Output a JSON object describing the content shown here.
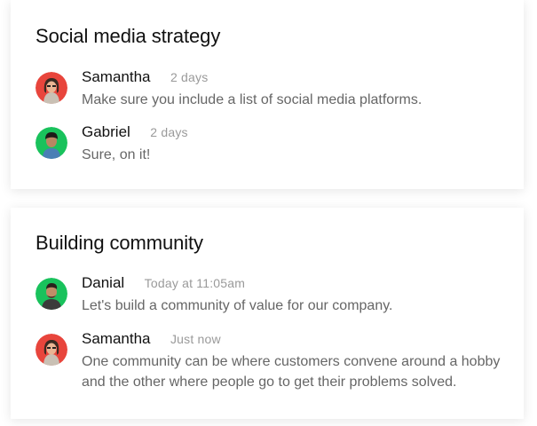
{
  "threads": [
    {
      "title": "Social media strategy",
      "comments": [
        {
          "author": "Samantha",
          "time": "2 days",
          "text": "Make sure you include a list of social media platforms.",
          "avatar_color": "#e8453c"
        },
        {
          "author": "Gabriel",
          "time": "2 days",
          "text": "Sure, on it!",
          "avatar_color": "#19c25c"
        }
      ]
    },
    {
      "title": "Building community",
      "comments": [
        {
          "author": "Danial",
          "time": "Today at 11:05am",
          "text": "Let's build a community of value for our company.",
          "avatar_color": "#19c25c"
        },
        {
          "author": "Samantha",
          "time": "Just now",
          "text": "One community can be where customers convene around a hobby and the other where people go to get their problems solved.",
          "avatar_color": "#e8453c"
        }
      ]
    }
  ]
}
